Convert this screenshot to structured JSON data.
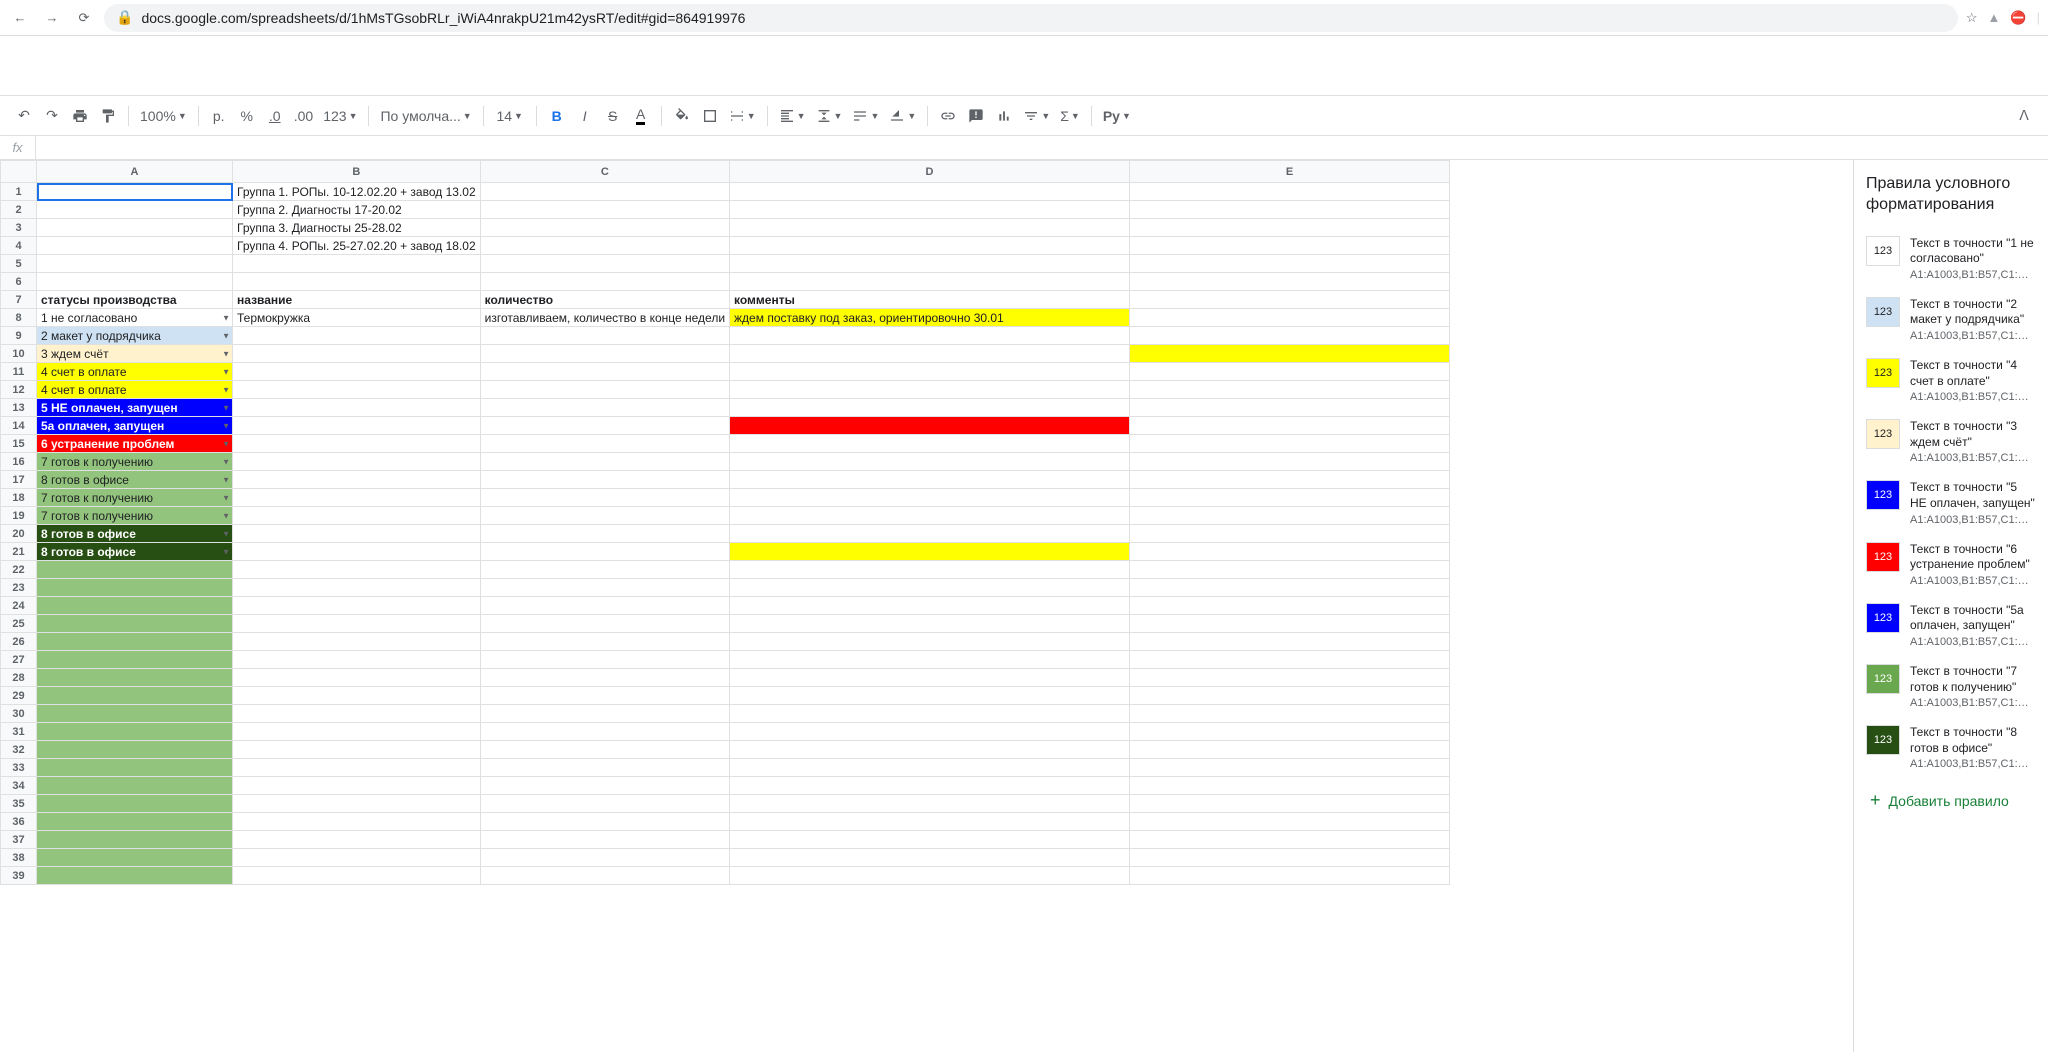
{
  "browser": {
    "url": "docs.google.com/spreadsheets/d/1hMsTGsobRLr_iWiA4nrakpU21m42ysRT/edit#gid=864919976"
  },
  "toolbar": {
    "zoom": "100%",
    "currency": "р.",
    "percent": "%",
    "dec_less": ".0",
    "dec_more": ".00",
    "num_fmt": "123",
    "font": "По умолча...",
    "font_size": "14",
    "formula": "Рy"
  },
  "sidepanel": {
    "title": "Правила условного форматирования",
    "add_rule": "Добавить правило",
    "rules": [
      {
        "swatch_bg": "#ffffff",
        "swatch_txt": "123",
        "label": "Текст в точности \"1 не согласовано\"",
        "range": "A1:A1003,B1:B57,C1:C47..."
      },
      {
        "swatch_bg": "#cfe2f3",
        "swatch_txt": "123",
        "label": "Текст в точности \"2 макет у подрядчика\"",
        "range": "A1:A1003,B1:B57,C1:C47..."
      },
      {
        "swatch_bg": "#ffff00",
        "swatch_txt": "123",
        "label": "Текст в точности \"4 счет в оплате\"",
        "range": "A1:A1003,B1:B57,C1:C47..."
      },
      {
        "swatch_bg": "#fff2cc",
        "swatch_txt": "123",
        "label": "Текст в точности \"3 ждем счёт\"",
        "range": "A1:A1003,B1:B57,C1:C47..."
      },
      {
        "swatch_bg": "#0000ff",
        "swatch_txt": "123",
        "swatch_color": "#ffffff",
        "label": "Текст в точности \"5 НЕ оплачен, запущен\"",
        "range": "A1:A1003,B1:B57,C1:C47..."
      },
      {
        "swatch_bg": "#ff0000",
        "swatch_txt": "123",
        "swatch_color": "#ffffff",
        "label": "Текст в точности \"6 устранение проблем\"",
        "range": "A1:A1003,B1:B57,C1:C47..."
      },
      {
        "swatch_bg": "#0000ff",
        "swatch_txt": "123",
        "swatch_color": "#ffffff",
        "label": "Текст в точности \"5а оплачен, запущен\"",
        "range": "A1:A1003,B1:B57,C1:C47..."
      },
      {
        "swatch_bg": "#6aa84f",
        "swatch_txt": "123",
        "swatch_color": "#ffffff",
        "label": "Текст в точности \"7 готов к получению\"",
        "range": "A1:A1003,B1:B57,C1:C47..."
      },
      {
        "swatch_bg": "#274e13",
        "swatch_txt": "123",
        "swatch_color": "#ffffff",
        "label": "Текст в точности \"8 готов в офисе\"",
        "range": "A1:A1003,B1:B57,C1:C47..."
      }
    ]
  },
  "sheet": {
    "columns": [
      "A",
      "B",
      "C",
      "D",
      "E"
    ],
    "rows": [
      {
        "n": 1,
        "cells": {
          "B": "Группа 1. РОПы. 10-12.02.20 + завод 13.02"
        },
        "active": "A"
      },
      {
        "n": 2,
        "cells": {
          "B": "Группа 2. Диагносты 17-20.02"
        }
      },
      {
        "n": 3,
        "cells": {
          "B": "Группа 3. Диагносты 25-28.02"
        }
      },
      {
        "n": 4,
        "cells": {
          "B": "Группа 4. РОПы. 25-27.02.20 + завод 18.02"
        }
      },
      {
        "n": 5,
        "cells": {}
      },
      {
        "n": 6,
        "cells": {}
      },
      {
        "n": 7,
        "cells": {
          "A": "статусы производства",
          "B": "название",
          "C": "количество",
          "D": "комменты"
        },
        "bold": true
      },
      {
        "n": 8,
        "cells": {
          "A": "1 не согласовано",
          "B": "Термокружка",
          "C": "изготавливаем, количество в конце недели",
          "D": "ждем поставку под заказ, ориентировочно 30.01"
        },
        "bg": {
          "A": "#ffffff",
          "D": "#ffff00"
        },
        "dd": true
      },
      {
        "n": 9,
        "cells": {
          "A": "2 макет у подрядчика"
        },
        "bg": {
          "A": "#cfe2f3"
        },
        "dd": true
      },
      {
        "n": 10,
        "cells": {
          "A": "3 ждем счёт"
        },
        "bg": {
          "A": "#fff2cc",
          "E": "#ffff00"
        },
        "dd": true
      },
      {
        "n": 11,
        "cells": {
          "A": "4 счет в оплате"
        },
        "bg": {
          "A": "#ffff00"
        },
        "dd": true
      },
      {
        "n": 12,
        "cells": {
          "A": "4 счет в оплате"
        },
        "bg": {
          "A": "#ffff00"
        },
        "dd": true
      },
      {
        "n": 13,
        "cells": {
          "A": "5 НЕ оплачен, запущен"
        },
        "bg": {
          "A": "#0000ff"
        },
        "fg": {
          "A": "#ffffff"
        },
        "dd": true,
        "boldA": true
      },
      {
        "n": 14,
        "cells": {
          "A": "5а оплачен, запущен"
        },
        "bg": {
          "A": "#0000ff",
          "D": "#ff0000"
        },
        "fg": {
          "A": "#ffffff"
        },
        "dd": true,
        "boldA": true
      },
      {
        "n": 15,
        "cells": {
          "A": "6 устранение проблем"
        },
        "bg": {
          "A": "#ff0000"
        },
        "fg": {
          "A": "#ffffff"
        },
        "dd": true,
        "boldA": true
      },
      {
        "n": 16,
        "cells": {
          "A": "7 готов к получению"
        },
        "bg": {
          "A": "#93c47d"
        },
        "dd": true
      },
      {
        "n": 17,
        "cells": {
          "A": "8 готов в офисе"
        },
        "bg": {
          "A": "#93c47d"
        },
        "dd": true
      },
      {
        "n": 18,
        "cells": {
          "A": "7 готов к получению"
        },
        "bg": {
          "A": "#93c47d"
        },
        "dd": true
      },
      {
        "n": 19,
        "cells": {
          "A": "7 готов к получению"
        },
        "bg": {
          "A": "#93c47d"
        },
        "dd": true
      },
      {
        "n": 20,
        "cells": {
          "A": "8 готов в офисе"
        },
        "bg": {
          "A": "#274e13"
        },
        "fg": {
          "A": "#ffffff"
        },
        "dd": true,
        "boldA": true
      },
      {
        "n": 21,
        "cells": {
          "A": "8 готов в офисе"
        },
        "bg": {
          "A": "#274e13",
          "D": "#ffff00"
        },
        "fg": {
          "A": "#ffffff"
        },
        "dd": true,
        "boldA": true
      },
      {
        "n": 22,
        "cells": {},
        "bg": {
          "A": "#93c47d"
        }
      },
      {
        "n": 23,
        "cells": {},
        "bg": {
          "A": "#93c47d"
        }
      },
      {
        "n": 24,
        "cells": {},
        "bg": {
          "A": "#93c47d"
        }
      },
      {
        "n": 25,
        "cells": {},
        "bg": {
          "A": "#93c47d"
        }
      },
      {
        "n": 26,
        "cells": {},
        "bg": {
          "A": "#93c47d"
        }
      },
      {
        "n": 27,
        "cells": {},
        "bg": {
          "A": "#93c47d"
        }
      },
      {
        "n": 28,
        "cells": {},
        "bg": {
          "A": "#93c47d"
        }
      },
      {
        "n": 29,
        "cells": {},
        "bg": {
          "A": "#93c47d"
        }
      },
      {
        "n": 30,
        "cells": {},
        "bg": {
          "A": "#93c47d"
        }
      },
      {
        "n": 31,
        "cells": {},
        "bg": {
          "A": "#93c47d"
        }
      },
      {
        "n": 32,
        "cells": {},
        "bg": {
          "A": "#93c47d"
        }
      },
      {
        "n": 33,
        "cells": {},
        "bg": {
          "A": "#93c47d"
        }
      },
      {
        "n": 34,
        "cells": {},
        "bg": {
          "A": "#93c47d"
        }
      },
      {
        "n": 35,
        "cells": {},
        "bg": {
          "A": "#93c47d"
        }
      },
      {
        "n": 36,
        "cells": {},
        "bg": {
          "A": "#93c47d"
        }
      },
      {
        "n": 37,
        "cells": {},
        "bg": {
          "A": "#93c47d"
        }
      },
      {
        "n": 38,
        "cells": {},
        "bg": {
          "A": "#93c47d"
        }
      },
      {
        "n": 39,
        "cells": {},
        "bg": {
          "A": "#93c47d"
        }
      }
    ]
  }
}
